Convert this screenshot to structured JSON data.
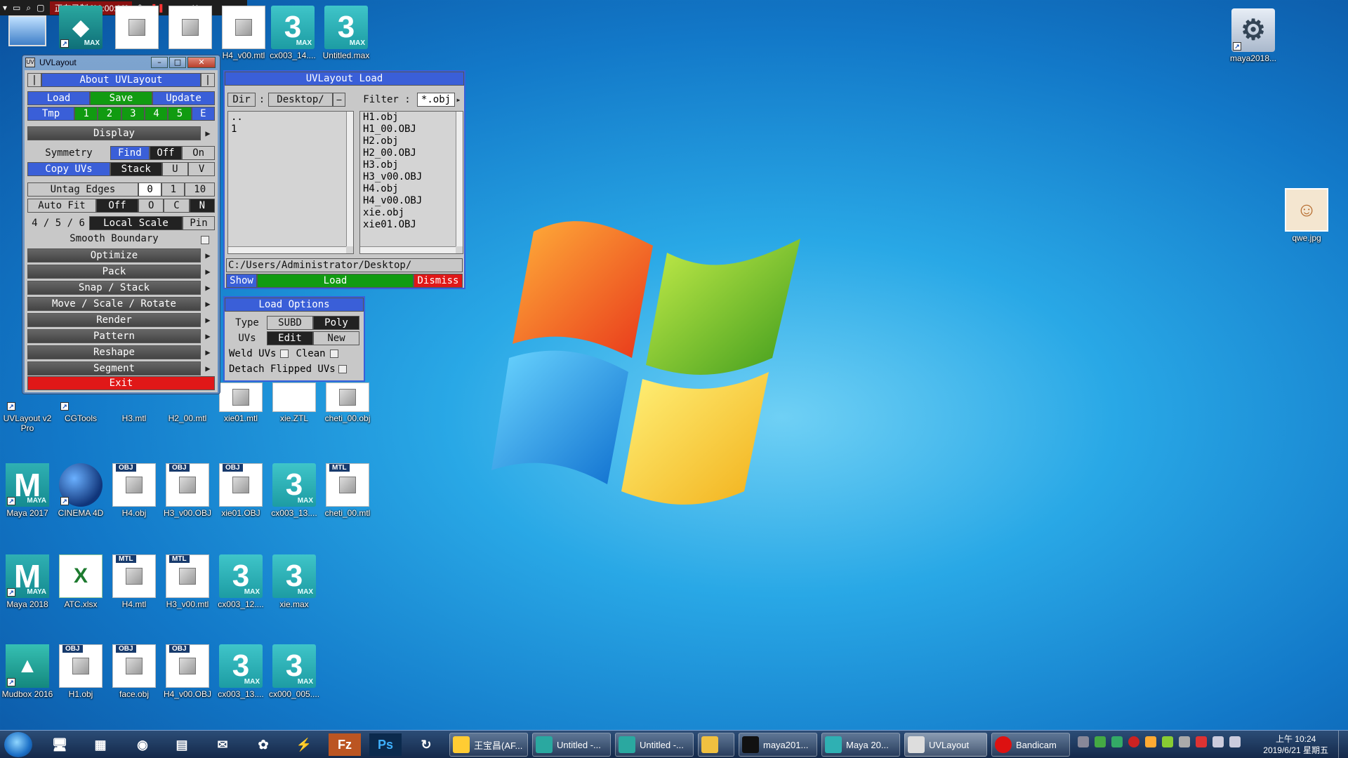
{
  "recorder": {
    "status": "正在录制 [00:00:08]"
  },
  "desktop_icons": {
    "top_row": [
      {
        "label": "",
        "type": "max"
      },
      {
        "label": "",
        "type": "file"
      },
      {
        "label": "",
        "type": "file"
      },
      {
        "label": "H4_v00.mtl",
        "type": "file"
      },
      {
        "label": "cx003_14....",
        "type": "max"
      },
      {
        "label": "Untitled.max",
        "type": "max"
      }
    ],
    "right": [
      {
        "label": "maya2018...",
        "type": "gear"
      },
      {
        "label": "qwe.jpg",
        "type": "img"
      }
    ],
    "row2": [
      {
        "label": "UVLayout v2 Pro",
        "type": "uv"
      },
      {
        "label": "CGTools",
        "type": "blank"
      },
      {
        "label": "H3.mtl",
        "type": "file"
      },
      {
        "label": "H2_00.mtl",
        "type": "file"
      },
      {
        "label": "xie01.mtl",
        "type": "file"
      },
      {
        "label": "xie.ZTL",
        "type": "blank"
      },
      {
        "label": "cheti_00.obj",
        "type": "file"
      }
    ],
    "row3": [
      {
        "label": "Maya 2017",
        "type": "maya"
      },
      {
        "label": "CINEMA 4D",
        "type": "c4d"
      },
      {
        "label": "H4.obj",
        "type": "obj"
      },
      {
        "label": "H3_v00.OBJ",
        "type": "obj"
      },
      {
        "label": "xie01.OBJ",
        "type": "obj"
      },
      {
        "label": "cx003_13....",
        "type": "max"
      },
      {
        "label": "cheti_00.mtl",
        "type": "mtl"
      }
    ],
    "row4": [
      {
        "label": "Maya 2018",
        "type": "maya"
      },
      {
        "label": "ATC.xlsx",
        "type": "xls"
      },
      {
        "label": "H4.mtl",
        "type": "mtl"
      },
      {
        "label": "H3_v00.mtl",
        "type": "mtl"
      },
      {
        "label": "cx003_12....",
        "type": "max"
      },
      {
        "label": "xie.max",
        "type": "max"
      }
    ],
    "row5": [
      {
        "label": "Mudbox 2016",
        "type": "mud"
      },
      {
        "label": "H1.obj",
        "type": "obj"
      },
      {
        "label": "face.obj",
        "type": "obj"
      },
      {
        "label": "H4_v00.OBJ",
        "type": "obj"
      },
      {
        "label": "cx003_13....",
        "type": "max"
      },
      {
        "label": "cx000_005....",
        "type": "max"
      }
    ]
  },
  "uvlayout": {
    "window_title": "UVLayout",
    "about": "About UVLayout",
    "load": "Load",
    "save": "Save",
    "update": "Update",
    "tmp": "Tmp",
    "tmp_slots": [
      "1",
      "2",
      "3",
      "4",
      "5",
      "E"
    ],
    "display": "Display",
    "symmetry": "Symmetry",
    "find": "Find",
    "off": "Off",
    "on": "On",
    "copy_uvs": "Copy UVs",
    "stack": "Stack",
    "u": "U",
    "v": "V",
    "untag_edges": "Untag Edges",
    "untag_vals": [
      "0",
      "1",
      "10"
    ],
    "auto_fit": "Auto Fit",
    "auto_off": "Off",
    "auto_vals": [
      "O",
      "C",
      "N"
    ],
    "ratio": "4 / 5 / 6",
    "local_scale": "Local Scale",
    "pin": "Pin",
    "smooth_boundary": "Smooth Boundary",
    "sections": [
      "Optimize",
      "Pack",
      "Snap / Stack",
      "Move / Scale / Rotate",
      "Render",
      "Pattern",
      "Reshape",
      "Segment"
    ],
    "exit": "Exit"
  },
  "load_dialog": {
    "title": "UVLayout Load",
    "dir_label": "Dir",
    "dir_sep": ":",
    "dir_value": "Desktop/",
    "filter_label": "Filter :",
    "filter_value": "*.obj",
    "dirs": [
      "..",
      "1"
    ],
    "files": [
      "H1.obj",
      "H1_00.OBJ",
      "H2.obj",
      "H2_00.OBJ",
      "H3.obj",
      "H3_v00.OBJ",
      "H4.obj",
      "H4_v00.OBJ",
      "xie.obj",
      "xie01.OBJ"
    ],
    "path": "C:/Users/Administrator/Desktop/",
    "show": "Show",
    "load": "Load",
    "dismiss": "Dismiss"
  },
  "load_options": {
    "title": "Load Options",
    "type": "Type",
    "subd": "SUBD",
    "poly": "Poly",
    "uvs": "UVs",
    "edit": "Edit",
    "new": "New",
    "weld_uvs": "Weld UVs",
    "clean": "Clean",
    "detach_flipped": "Detach Flipped UVs"
  },
  "taskbar": {
    "tasks": [
      "王宝昌(AF...",
      "Untitled -...",
      "Untitled -...",
      "",
      "maya201...",
      "Maya 20...",
      "UVLayout",
      "Bandicam"
    ],
    "clock_time": "上午 10:24",
    "clock_date": "2019/6/21 星期五"
  }
}
